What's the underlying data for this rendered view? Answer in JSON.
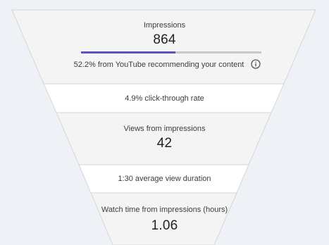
{
  "funnel": {
    "impressions": {
      "label": "Impressions",
      "value": "864",
      "youtube_recommend_fraction": 0.522,
      "youtube_recommend_text": "52.2% from YouTube recommending your content"
    },
    "ctr": {
      "text": "4.9% click-through rate"
    },
    "views": {
      "label": "Views from impressions",
      "value": "42"
    },
    "avg_duration": {
      "text": "1:30 average view duration"
    },
    "watch_time": {
      "label": "Watch time from impressions (hours)",
      "value": "1.06"
    }
  },
  "colors": {
    "progress_fill": "#5a53c8",
    "progress_track": "#c8c8c8",
    "funnel_grey": "#f4f4f4",
    "funnel_white": "#ffffff",
    "funnel_border": "#d6d6d6",
    "background": "#eef2f7"
  },
  "icons": {
    "info": "info-icon"
  }
}
